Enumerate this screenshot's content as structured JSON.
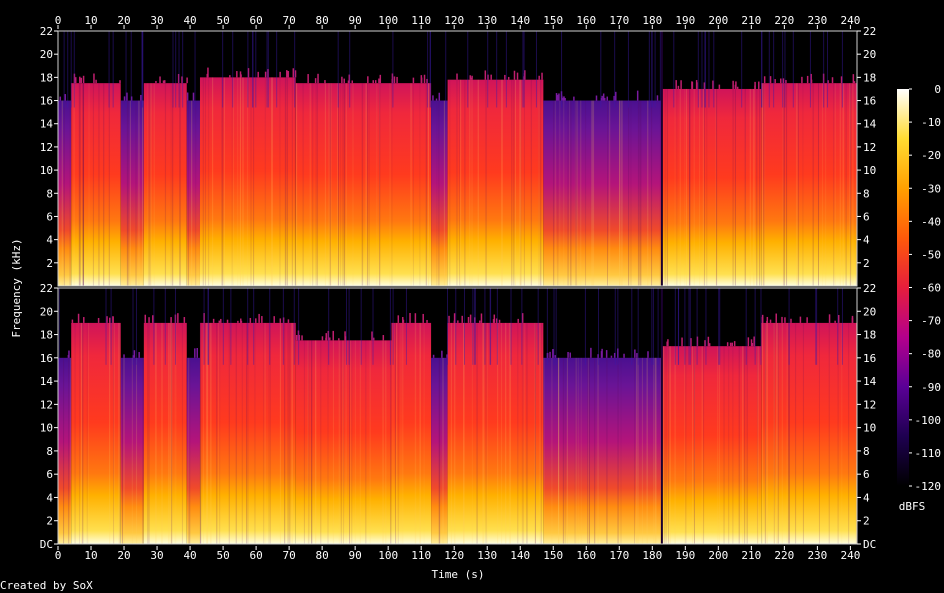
{
  "chart_data": {
    "type": "heatmap",
    "title": "",
    "xlabel": "Time (s)",
    "ylabel": "Frequency (kHz)",
    "xlim": [
      0,
      242
    ],
    "ylim": [
      0,
      22
    ],
    "x_ticks": [
      0,
      10,
      20,
      30,
      40,
      50,
      60,
      70,
      80,
      90,
      100,
      110,
      120,
      130,
      140,
      150,
      160,
      170,
      180,
      190,
      200,
      210,
      220,
      230,
      240
    ],
    "y_ticks": [
      {
        "value": 0,
        "label": "DC"
      },
      {
        "value": 2,
        "label": "2"
      },
      {
        "value": 4,
        "label": "4"
      },
      {
        "value": 6,
        "label": "6"
      },
      {
        "value": 8,
        "label": "8"
      },
      {
        "value": 10,
        "label": "10"
      },
      {
        "value": 12,
        "label": "12"
      },
      {
        "value": 14,
        "label": "14"
      },
      {
        "value": 16,
        "label": "16"
      },
      {
        "value": 18,
        "label": "18"
      },
      {
        "value": 20,
        "label": "20"
      },
      {
        "value": 22,
        "label": "22"
      }
    ],
    "channels": [
      {
        "name": "top",
        "segments": [
          {
            "start": 0,
            "end": 4,
            "cutoff_khz": 16,
            "intensity": 0.35
          },
          {
            "start": 4,
            "end": 19,
            "cutoff_khz": 17.5,
            "intensity": 0.8
          },
          {
            "start": 19,
            "end": 26,
            "cutoff_khz": 16,
            "intensity": 0.55
          },
          {
            "start": 26,
            "end": 39,
            "cutoff_khz": 17.5,
            "intensity": 0.85
          },
          {
            "start": 39,
            "end": 43,
            "cutoff_khz": 16,
            "intensity": 0.6
          },
          {
            "start": 43,
            "end": 72,
            "cutoff_khz": 18,
            "intensity": 0.85
          },
          {
            "start": 72,
            "end": 113,
            "cutoff_khz": 17.5,
            "intensity": 0.8
          },
          {
            "start": 113,
            "end": 118,
            "cutoff_khz": 16,
            "intensity": 0.55
          },
          {
            "start": 118,
            "end": 147,
            "cutoff_khz": 17.8,
            "intensity": 0.85
          },
          {
            "start": 147,
            "end": 183,
            "cutoff_khz": 16,
            "intensity": 0.45
          },
          {
            "start": 183,
            "end": 213,
            "cutoff_khz": 17,
            "intensity": 0.8
          },
          {
            "start": 213,
            "end": 242,
            "cutoff_khz": 17.5,
            "intensity": 0.85
          }
        ]
      },
      {
        "name": "bottom",
        "segments": [
          {
            "start": 0,
            "end": 4,
            "cutoff_khz": 16,
            "intensity": 0.35
          },
          {
            "start": 4,
            "end": 19,
            "cutoff_khz": 19,
            "intensity": 0.82
          },
          {
            "start": 19,
            "end": 26,
            "cutoff_khz": 16,
            "intensity": 0.55
          },
          {
            "start": 26,
            "end": 39,
            "cutoff_khz": 19,
            "intensity": 0.85
          },
          {
            "start": 39,
            "end": 43,
            "cutoff_khz": 16,
            "intensity": 0.6
          },
          {
            "start": 43,
            "end": 72,
            "cutoff_khz": 19,
            "intensity": 0.85
          },
          {
            "start": 72,
            "end": 101,
            "cutoff_khz": 17.5,
            "intensity": 0.8
          },
          {
            "start": 101,
            "end": 113,
            "cutoff_khz": 19,
            "intensity": 0.85
          },
          {
            "start": 113,
            "end": 118,
            "cutoff_khz": 16,
            "intensity": 0.55
          },
          {
            "start": 118,
            "end": 147,
            "cutoff_khz": 19,
            "intensity": 0.85
          },
          {
            "start": 147,
            "end": 183,
            "cutoff_khz": 16,
            "intensity": 0.45
          },
          {
            "start": 183,
            "end": 213,
            "cutoff_khz": 17,
            "intensity": 0.8
          },
          {
            "start": 213,
            "end": 242,
            "cutoff_khz": 19,
            "intensity": 0.85
          }
        ]
      }
    ],
    "colorbar": {
      "label": "dBFS",
      "min": -120,
      "max": 0,
      "ticks": [
        0,
        -10,
        -20,
        -30,
        -40,
        -50,
        -60,
        -70,
        -80,
        -90,
        -100,
        -110,
        -120
      ],
      "stops": [
        "#000000",
        "#1e0050",
        "#5a0096",
        "#b4008c",
        "#e61e3c",
        "#ff5a0a",
        "#ffa000",
        "#ffdc32",
        "#ffffff"
      ]
    }
  },
  "footer": {
    "credit": "Created by SoX"
  }
}
